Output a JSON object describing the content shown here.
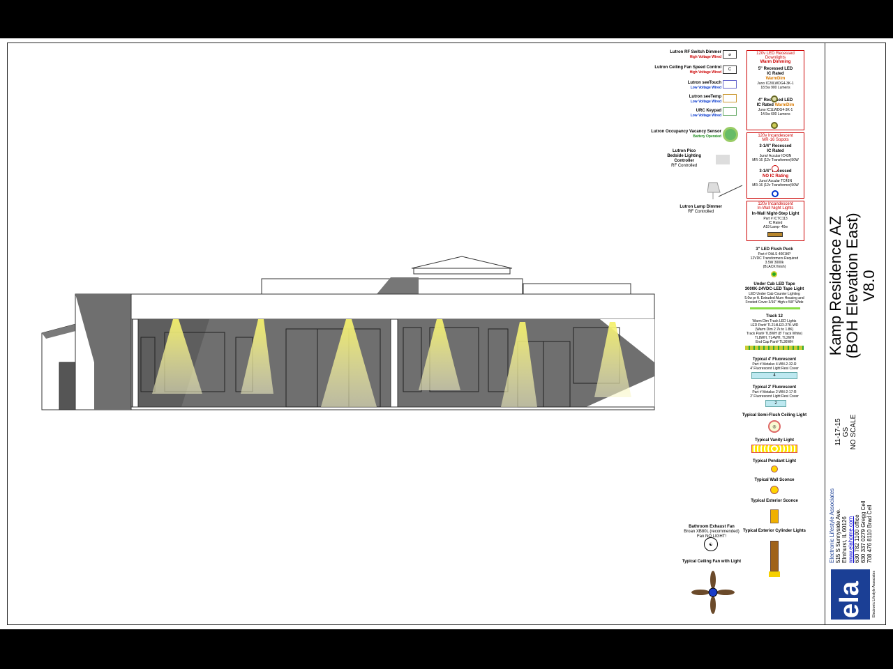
{
  "project": {
    "title": "Kamp Residence AZ",
    "subtitle": "(BOH Elevation East)",
    "version": "V8.0",
    "date": "11-17-15",
    "initials": "GS",
    "scale": "NO SCALE"
  },
  "company": {
    "name": "Electronic Lifestyle Associates",
    "street": "515 S Sunnyside Ave.",
    "city": "Elmhurst, IL 60126",
    "web": "www.elahome.com",
    "office": "630 782 1100 office",
    "cell1": "630 337 0279 Gregg Cell",
    "cell2": "708 476 8110 Brad Cell",
    "logo": "ela",
    "logo_sub": "Electronic Lifestyle Associates",
    "logo_color": "#1b3f95"
  },
  "legend_left": [
    {
      "title": "Lutron RF Switch Dimmer",
      "sub": "High Voltage Wired",
      "sub_color": "red",
      "icon": "rf-dimmer-icon"
    },
    {
      "title": "Lutron Ceiling Fan Speed Control",
      "sub": "High Voltage Wired",
      "sub_color": "red",
      "icon": "fan-control-icon"
    },
    {
      "title": "Lutron seeTouch",
      "sub": "Low Voltage Wired",
      "sub_color": "blue",
      "icon": "seetouch-icon"
    },
    {
      "title": "Lutron seeTemp",
      "sub": "Low Voltage Wired",
      "sub_color": "blue",
      "icon": "seetemp-icon"
    },
    {
      "title": "URC Keypad",
      "sub": "Low Voltage Wired",
      "sub_color": "blue",
      "icon": "keypad-icon"
    },
    {
      "title": "Lutron Occupancy Vacancy Sensor",
      "sub": "Battery Operated",
      "sub_color": "green",
      "icon": "occupancy-sensor-icon"
    }
  ],
  "pico": {
    "l1": "Lutron Pico",
    "l2": "Bedside Lighting",
    "l3": "Controller",
    "sub": "RF Controlled"
  },
  "lamp": {
    "title": "Lutron Lamp Dimmer",
    "sub": "RF Controlled"
  },
  "exhaust": {
    "title": "Bathroom Exhaust Fan",
    "l1": "Broan XB80L (recommended)",
    "l2": "Fan NO LIGHT!"
  },
  "ceiling_fan": {
    "title": "Typical Ceiling Fan with Light"
  },
  "led_box": {
    "head1": "120v LED Recessed",
    "head2": "Downlights",
    "head3": "Warm Dimming",
    "a_t1": "5\" Recessed LED",
    "a_t2": "IC Rated",
    "a_t3": "WarmDim",
    "a_l1": "Juno IC20LWDG4-3K-1",
    "a_l2": "18.5w 900 Lumens",
    "b_t1": "4\" Recessed LED",
    "b_t2": "IC Rated",
    "b_t3": "WarmDim",
    "b_l1": "Juno IC1LWDG4-3K-1",
    "b_l2": "14.5w 600 Lumens"
  },
  "mr16_box": {
    "head1": "120v Incandescent",
    "head2": "MR-16 Sopots",
    "a_t1": "3-1/4\" Recessed",
    "a_t2": "IC Rated",
    "a_l1": "Juno/ Accular IC43N",
    "a_l2": "MR-16 (12v Transformer)50W",
    "b_t1": "3-1/4\" Recessed",
    "b_t2": "NO IC Rating",
    "b_l1": "Juno/ Accular TC43N",
    "b_l2": "MR-16 (12v Transformer)50W"
  },
  "night_box": {
    "head1": "120v Incandescent",
    "head2": "In-Wall Night Lights",
    "t1": "In-Wall Night-Step Light",
    "l1": "Part # ICTC113",
    "l2": "IC Rated",
    "l3": "A19 Lamp- 40w"
  },
  "puck": {
    "t": "3\" LED Flush Puck",
    "l1": "Part # DALS 4001KP",
    "l2": "12VDC Transformers Required",
    "l3": "3.5W 3000k",
    "l4": "(BLACK finish)"
  },
  "tape": {
    "t1": "Under Cab LED Tape",
    "t2": "3000K-24VDC-LED Tape Light",
    "l1": "LED Under Cab Counter Lighting",
    "l2": "5.0w pr ft. Extruded Alum Housing and",
    "l3": "Frosted Cover 3/16\" High x 5/8\" Wide"
  },
  "track": {
    "t": "Track 12",
    "l1": "Warm Dim Track LED Lights",
    "l2": "LED Part# TL214LED-27K-WD",
    "l3": "(Warm Dim 2.7k to 1.8K)",
    "l4": "Track Part# TL8WH (8' Track White)",
    "l5": "TL8WH, TL4WH, TL2WH",
    "l6": "End Cap Part# TL36WH"
  },
  "fl4": {
    "t": "Typical 4' Fluorescent",
    "l1": "Part # Metalux 4-WN-2-32-R",
    "l2": "4' Fluorescent Light Resi Cover",
    "sym": "4"
  },
  "fl2": {
    "t": "Typical 2' Fluorescent",
    "l1": "Part # Metalux 2-WN-2-17-R",
    "l2": "2' Fluorescent Light Resi Cover",
    "sym": "2"
  },
  "typicals": {
    "semi": "Typical Semi-Flush Ceiling Light",
    "vanity": "Typical Vanity Light",
    "pendant": "Typical Pendant Light",
    "wall": "Typical Wall Sconce",
    "exterior": "Typical Exterior Sconce",
    "cylinder": "Typical Exterior Cylinder Lights"
  },
  "colors": {
    "wall": "#6f6f6f",
    "light_cone": "#f2f08c",
    "line": "#333333"
  }
}
